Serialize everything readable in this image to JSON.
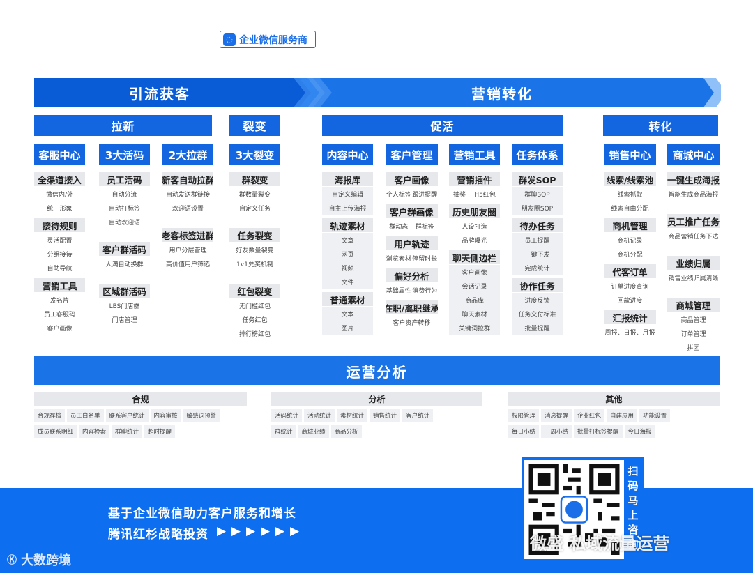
{
  "badge": {
    "label": "企业微信服务商"
  },
  "banners": {
    "left": "引流获客",
    "right": "营销转化"
  },
  "groups": {
    "laxin": "拉新",
    "liebian": "裂变",
    "cuhuo": "促活",
    "zhuanhua": "转化"
  },
  "columns": {
    "c1": {
      "title": "客服中心",
      "s1": "全渠道接入",
      "s1a": "微信内/外",
      "s1b": "统一形象",
      "s2": "接待规则",
      "s2a": "灵活配置",
      "s2b": "分组接待",
      "s2c": "自助导航",
      "s3": "营销工具",
      "s3a": "发名片",
      "s3b": "员工客服码",
      "s3c": "客户画像"
    },
    "c2": {
      "title": "3大活码",
      "s1": "员工活码",
      "s1a": "自动分流",
      "s1b": "自动打标签",
      "s1c": "自动欢迎语",
      "s2": "客户群活码",
      "s2a": "人满自动换群",
      "s3": "区域群活码",
      "s3a": "LBS门店群",
      "s3b": "门店管理"
    },
    "c3": {
      "title": "2大拉群",
      "s1": "新客自动拉群",
      "s1a": "自动发送群链接",
      "s1b": "欢迎语设置",
      "s2": "老客标签进群",
      "s2a": "用户分层管理",
      "s2b": "高价值用户筛选"
    },
    "c4": {
      "title": "3大裂变",
      "s1": "群裂变",
      "s1a": "群数量裂变",
      "s1b": "自定义任务",
      "s2": "任务裂变",
      "s2a": "好友数量裂变",
      "s2b": "1v1兑奖机制",
      "s3": "红包裂变",
      "s3a": "无门槛红包",
      "s3b": "任务红包",
      "s3c": "排行榜红包"
    },
    "c5": {
      "title": "内容中心",
      "s1": "海报库",
      "s1a": "自定义编辑",
      "s1b": "自主上传海报",
      "s2": "轨迹素材",
      "s2a": "文章",
      "s2b": "网页",
      "s2c": "视频",
      "s2d": "文件",
      "s3": "普通素材",
      "s3a": "文本",
      "s3b": "图片"
    },
    "c6": {
      "title": "客户管理",
      "s1": "客户画像",
      "s1a": "个人标签",
      "s1b": "跟进提醒",
      "s2": "客户群画像",
      "s2a": "群动态",
      "s2b": "群标签",
      "s3": "用户轨迹",
      "s3a": "浏览素材",
      "s3b": "停留时长",
      "s4": "偏好分析",
      "s4a": "基础属性",
      "s4b": "消费行为",
      "s5": "在职/离职继承",
      "s5a": "客户资产转移"
    },
    "c7": {
      "title": "营销工具",
      "s1": "营销插件",
      "s1a": "抽奖",
      "s1b": "H5红包",
      "s2": "历史朋友圈",
      "s2a": "人设打造",
      "s2b": "品牌曝光",
      "s3": "聊天侧边栏",
      "s3a": "客户画像",
      "s3b": "会话记录",
      "s3c": "商品库",
      "s3d": "聊天素材",
      "s3e": "关键词拉群"
    },
    "c8": {
      "title": "任务体系",
      "s1": "群发SOP",
      "s1a": "群聊SOP",
      "s1b": "朋友圈SOP",
      "s2": "待办任务",
      "s2a": "员工提醒",
      "s2b": "一键下发",
      "s2c": "完成统计",
      "s3": "协作任务",
      "s3a": "进度反馈",
      "s3b": "任务交付标准",
      "s3c": "批量提醒"
    },
    "c9": {
      "title": "销售中心",
      "s1": "线索/线索池",
      "s1a": "线索抓取",
      "s1b": "线索自由分配",
      "s2": "商机管理",
      "s2a": "商机记录",
      "s2b": "商机分配",
      "s3": "代客订单",
      "s3a": "订单进度查询",
      "s3b": "回款进度",
      "s4": "汇报统计",
      "s4a": "周报、日报、月报"
    },
    "c10": {
      "title": "商城中心",
      "s1": "一键生成海报",
      "s1a": "智能生成商品海报",
      "s2": "员工推广任务",
      "s2a": "商品营销任务下达",
      "s3": "业绩归属",
      "s3a": "销售业绩归属清晰",
      "s4": "商城管理",
      "s4a": "商品管理",
      "s4b": "订单管理",
      "s4c": "拼团"
    }
  },
  "analysis": {
    "title": "运营分析",
    "g1": {
      "title": "合规",
      "r1": [
        "合规存档",
        "员工白名单",
        "联系客户统计",
        "内容审核",
        "敏感词预警"
      ],
      "r2": [
        "成员联系明细",
        "内容检索",
        "群聊统计",
        "超时提醒"
      ]
    },
    "g2": {
      "title": "分析",
      "r1": [
        "活码统计",
        "活动统计",
        "素材统计",
        "销售统计",
        "客户统计"
      ],
      "r2": [
        "群统计",
        "商城业绩",
        "商品分析"
      ]
    },
    "g3": {
      "title": "其他",
      "r1": [
        "权限管理",
        "消息提醒",
        "企业红包",
        "自建应用",
        "功能设置"
      ],
      "r2": [
        "每日小结",
        "一周小结",
        "批量打标签提醒",
        "今日海报"
      ]
    }
  },
  "footer": {
    "line1": "基于企业微信助力客户服务和增长",
    "line2": "腾讯红杉战略投资",
    "arrows": "▶ ▶ ▶ ▶ ▶ ▶",
    "logo": "大数跨境",
    "scan": "扫码马上咨询",
    "watermark": "微盛 私域流量运营"
  },
  "colors": {
    "primary": "#1366e0",
    "banner": "#0d6ef0",
    "light": "#e6e8ec"
  }
}
